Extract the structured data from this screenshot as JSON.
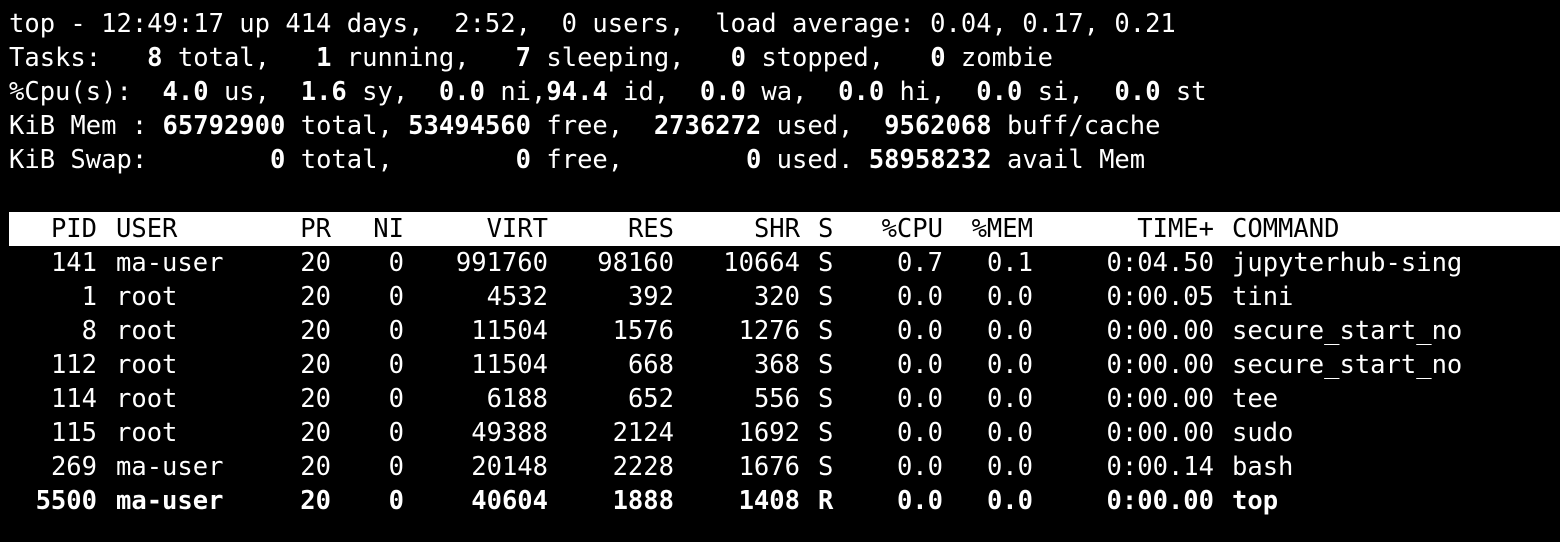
{
  "summary": {
    "uptime": {
      "prefix": "top - 12:49:17 up 414 days,  2:52,  0 users,  load average: 0.04, 0.17, 0.21"
    },
    "tasks": {
      "label": "Tasks: ",
      "total": "  8",
      "total_label": " total, ",
      "running": "  1",
      "running_label": " running, ",
      "sleeping": "  7",
      "sleeping_label": " sleeping, ",
      "stopped": "  0",
      "stopped_label": " stopped, ",
      "zombie": "  0",
      "zombie_label": " zombie"
    },
    "cpu": {
      "label": "%Cpu(s): ",
      "us": " 4.0",
      "us_label": " us, ",
      "sy": " 1.6",
      "sy_label": " sy, ",
      "ni": " 0.0",
      "ni_label": " ni,",
      "id": "94.4",
      "id_label": " id, ",
      "wa": " 0.0",
      "wa_label": " wa, ",
      "hi": " 0.0",
      "hi_label": " hi, ",
      "si": " 0.0",
      "si_label": " si, ",
      "st": " 0.0",
      "st_label": " st"
    },
    "mem": {
      "label": "KiB Mem : ",
      "total": "65792900",
      "total_label": " total,",
      "free": " 53494560",
      "free_label": " free, ",
      "used": " 2736272",
      "used_label": " used, ",
      "buff": " 9562068",
      "buff_label": " buff/cache"
    },
    "swap": {
      "label": "KiB Swap: ",
      "total": "       0",
      "total_label": " total, ",
      "free": "       0",
      "free_label": " free, ",
      "used": "       0",
      "used_label": " used.",
      "avail": " 58958232",
      "avail_label": " avail Mem"
    }
  },
  "table": {
    "headers": {
      "pid": "PID",
      "user": "USER",
      "pr": "PR",
      "ni": "NI",
      "virt": "VIRT",
      "res": "RES",
      "shr": "SHR",
      "s": "S",
      "cpu": "%CPU",
      "mem": "%MEM",
      "time": "TIME+",
      "command": "COMMAND"
    },
    "rows": [
      {
        "pid": "141",
        "user": "ma-user",
        "pr": "20",
        "ni": "0",
        "virt": "991760",
        "res": "98160",
        "shr": "10664",
        "s": "S",
        "cpu": "0.7",
        "mem": "0.1",
        "time": "0:04.50",
        "command": "jupyterhub-sing"
      },
      {
        "pid": "1",
        "user": "root",
        "pr": "20",
        "ni": "0",
        "virt": "4532",
        "res": "392",
        "shr": "320",
        "s": "S",
        "cpu": "0.0",
        "mem": "0.0",
        "time": "0:00.05",
        "command": "tini"
      },
      {
        "pid": "8",
        "user": "root",
        "pr": "20",
        "ni": "0",
        "virt": "11504",
        "res": "1576",
        "shr": "1276",
        "s": "S",
        "cpu": "0.0",
        "mem": "0.0",
        "time": "0:00.00",
        "command": "secure_start_no"
      },
      {
        "pid": "112",
        "user": "root",
        "pr": "20",
        "ni": "0",
        "virt": "11504",
        "res": "668",
        "shr": "368",
        "s": "S",
        "cpu": "0.0",
        "mem": "0.0",
        "time": "0:00.00",
        "command": "secure_start_no"
      },
      {
        "pid": "114",
        "user": "root",
        "pr": "20",
        "ni": "0",
        "virt": "6188",
        "res": "652",
        "shr": "556",
        "s": "S",
        "cpu": "0.0",
        "mem": "0.0",
        "time": "0:00.00",
        "command": "tee"
      },
      {
        "pid": "115",
        "user": "root",
        "pr": "20",
        "ni": "0",
        "virt": "49388",
        "res": "2124",
        "shr": "1692",
        "s": "S",
        "cpu": "0.0",
        "mem": "0.0",
        "time": "0:00.00",
        "command": "sudo"
      },
      {
        "pid": "269",
        "user": "ma-user",
        "pr": "20",
        "ni": "0",
        "virt": "20148",
        "res": "2228",
        "shr": "1676",
        "s": "S",
        "cpu": "0.0",
        "mem": "0.0",
        "time": "0:00.14",
        "command": "bash"
      },
      {
        "pid": "5500",
        "user": "ma-user",
        "pr": "20",
        "ni": "0",
        "virt": "40604",
        "res": "1888",
        "shr": "1408",
        "s": "R",
        "cpu": "0.0",
        "mem": "0.0",
        "time": "0:00.00",
        "command": "top",
        "highlighted": true
      }
    ]
  },
  "colors": {
    "background": "#000000",
    "foreground": "#ffffff",
    "header_bar": "#ffffff",
    "header_text": "#000000"
  }
}
